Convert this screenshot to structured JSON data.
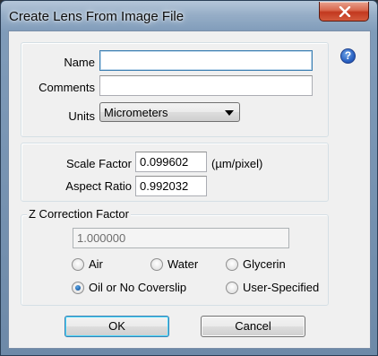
{
  "window": {
    "title": "Create Lens From Image File"
  },
  "colors": {
    "close_button": "#c7432b",
    "focus_border": "#3c7fb1",
    "radio_checked": "#1c5fa6"
  },
  "form": {
    "name_label": "Name",
    "name_value": "",
    "comments_label": "Comments",
    "comments_value": "",
    "units_label": "Units",
    "units_selected": "Micrometers",
    "help_icon_glyph": "?"
  },
  "scale": {
    "scale_factor_label": "Scale Factor",
    "scale_factor_value": "0.099602",
    "scale_factor_unit": "(µm/pixel)",
    "aspect_ratio_label": "Aspect Ratio",
    "aspect_ratio_value": "0.992032"
  },
  "z_correction": {
    "legend": "Z Correction Factor",
    "value": "1.000000",
    "options": [
      {
        "label": "Air",
        "checked": false
      },
      {
        "label": "Water",
        "checked": false
      },
      {
        "label": "Glycerin",
        "checked": false
      },
      {
        "label": "Oil or No Coverslip",
        "checked": true
      },
      {
        "label": "User-Specified",
        "checked": false
      }
    ]
  },
  "buttons": {
    "ok": "OK",
    "cancel": "Cancel"
  },
  "icons": {
    "close": "close-icon",
    "help": "help-icon",
    "dropdown": "chevron-down-icon"
  }
}
